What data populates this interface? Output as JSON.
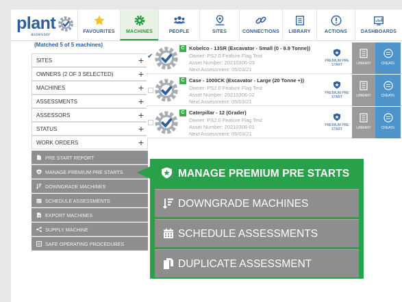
{
  "brand": {
    "name": "plant",
    "tagline": "assessor"
  },
  "nav": [
    {
      "label": "FAVOURITES",
      "icon": "star-icon",
      "active": false
    },
    {
      "label": "MACHINES",
      "icon": "gear-icon",
      "active": true
    },
    {
      "label": "PEOPLE",
      "icon": "people-icon",
      "active": false
    },
    {
      "label": "SITES",
      "icon": "map-pin-icon",
      "active": false
    },
    {
      "label": "CONNECTIONS",
      "icon": "link-icon",
      "active": false
    },
    {
      "label": "LIBRARY",
      "icon": "library-icon",
      "active": false
    },
    {
      "label": "ACTIONS",
      "icon": "alert-icon",
      "active": false
    },
    {
      "label": "DASHBOARDS",
      "icon": "dashboard-icon",
      "active": false
    }
  ],
  "sidebar": {
    "matched": "(Matched 5 of 5 machines)",
    "filters": [
      {
        "label": "SITES",
        "toggle": "+"
      },
      {
        "label": "OWNERS (2 OF 3 SELECTED)",
        "toggle": "+"
      },
      {
        "label": "MACHINES",
        "toggle": "+"
      },
      {
        "label": "ASSESSMENTS",
        "toggle": "+"
      },
      {
        "label": "ASSESSORS",
        "toggle": "+"
      },
      {
        "label": "STATUS",
        "toggle": "+"
      },
      {
        "label": "WORK ORDERS",
        "toggle": "+"
      }
    ],
    "actions": [
      {
        "label": "PRE START REPORT",
        "icon": "document-icon"
      },
      {
        "label": "MANAGE PREMIUM PRE STARTS",
        "icon": "shield-star-icon"
      },
      {
        "label": "DOWNGRADE MACHINES",
        "icon": "downgrade-icon"
      },
      {
        "label": "SCHEDULE ASSESSMENTS",
        "icon": "calendar-icon"
      },
      {
        "label": "EXPORT MACHINES",
        "icon": "export-icon"
      },
      {
        "label": "SUPPLY MACHINE",
        "icon": "share-icon"
      },
      {
        "label": "SAFE OPERATING PROCEDURES",
        "icon": "list-icon"
      }
    ]
  },
  "machines": [
    {
      "status": "C",
      "checked": true,
      "check_glyph": "✔",
      "title": "Kobelco - 13SR (Excavator - Small (0 - 9.9 Tonne))",
      "owner": "Owner: PS2.0 Feature Flag Test",
      "asset": "Asset Number: 20210306-03",
      "next": "Next Assessment: 05/03/21",
      "premium_label": "PREMIUM PRE START",
      "library_label": "LIBRARY",
      "create_label": "CREATE"
    },
    {
      "status": "C",
      "checked": false,
      "check_glyph": "",
      "title": "Case - 1000CK (Excavator - Large (20 Tonne +))",
      "owner": "Owner: PS2.0 Feature Flag Test",
      "asset": "Asset Number: 20210306-02",
      "next": "Next Assessment: 05/03/21",
      "premium_label": "PREMIUM PRE START",
      "library_label": "LIBRARY",
      "create_label": "CREATE"
    },
    {
      "status": "C",
      "checked": false,
      "check_glyph": "",
      "title": "Caterpillar - 12 (Grader)",
      "owner": "Owner: PS2.0 Feature Flag Test",
      "asset": "Asset Number: 20210306-01",
      "next": "Next Assessment: 05/03/21",
      "premium_label": "PREMIUM PRE START",
      "library_label": "LIBRARY",
      "create_label": "CREATE"
    }
  ],
  "callout": {
    "header": {
      "label": "MANAGE PREMIUM PRE STARTS",
      "icon": "shield-star-icon"
    },
    "items": [
      {
        "label": "DOWNGRADE MACHINES",
        "icon": "downgrade-icon"
      },
      {
        "label": "SCHEDULE ASSESSMENTS",
        "icon": "calendar-icon"
      },
      {
        "label": "DUPLICATE ASSESSMENT",
        "icon": "copy-icon"
      }
    ]
  },
  "colors": {
    "brand_blue": "#2d5f9b",
    "active_green": "#239b3c",
    "callout_green": "#29a04a",
    "action_gray": "#8e8e8e",
    "create_blue": "#4e93c9",
    "library_gray": "#9a9a9a"
  }
}
